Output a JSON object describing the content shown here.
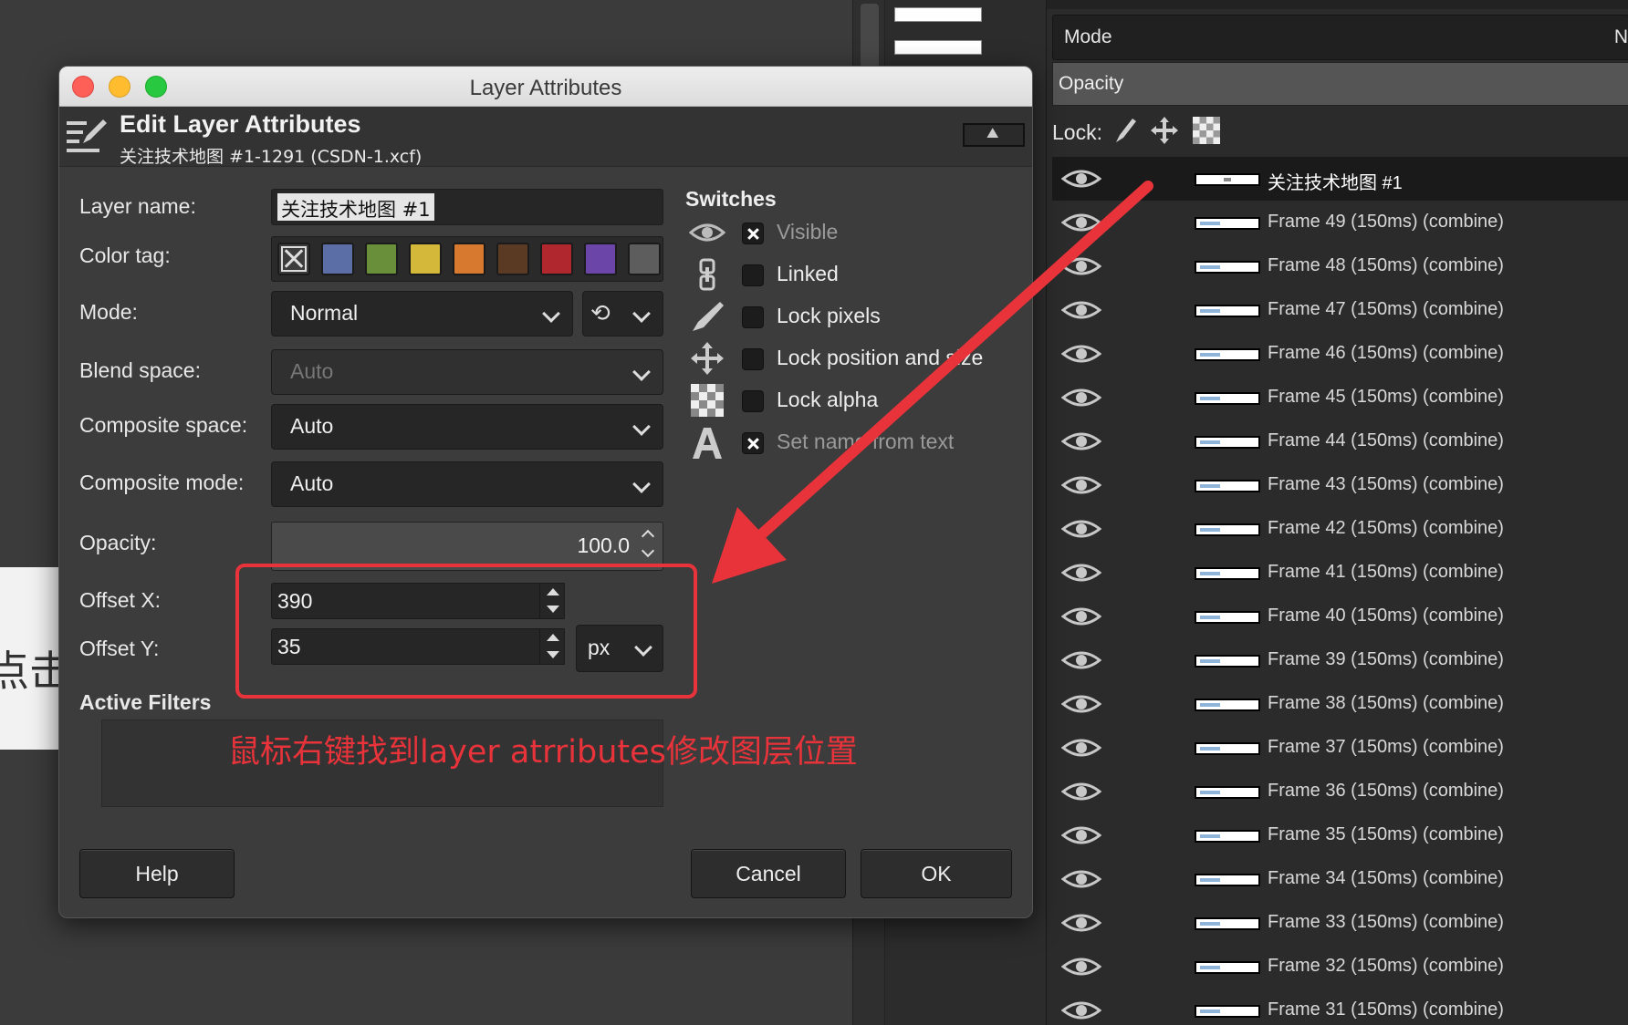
{
  "dialog": {
    "window_title": "Layer Attributes",
    "header_title": "Edit Layer Attributes",
    "header_subtitle": "关注技术地图 #1-1291 (CSDN-1.xcf)",
    "labels": {
      "layer_name": "Layer name:",
      "color_tag": "Color tag:",
      "mode": "Mode:",
      "blend_space": "Blend space:",
      "composite_space": "Composite space:",
      "composite_mode": "Composite mode:",
      "opacity": "Opacity:",
      "offset_x": "Offset X:",
      "offset_y": "Offset Y:",
      "active_filters": "Active Filters"
    },
    "layer_name_value": "关注技术地图 #1",
    "color_tags": [
      "#5b6fa6",
      "#6a8f3a",
      "#d4b83a",
      "#d77a2f",
      "#5a3a22",
      "#b0282e",
      "#6b45a8",
      "#5d5d5d"
    ],
    "mode_value": "Normal",
    "blend_space_value": "Auto",
    "composite_space_value": "Auto",
    "composite_mode_value": "Auto",
    "opacity_value": "100.0",
    "offset_x_value": "390",
    "offset_y_value": "35",
    "unit_value": "px",
    "switches": {
      "title": "Switches",
      "items": [
        {
          "label": "Visible",
          "checked": true,
          "dim": true
        },
        {
          "label": "Linked",
          "checked": false,
          "dim": false
        },
        {
          "label": "Lock pixels",
          "checked": false,
          "dim": false
        },
        {
          "label": "Lock position and size",
          "checked": false,
          "dim": false
        },
        {
          "label": "Lock alpha",
          "checked": false,
          "dim": false
        },
        {
          "label": "Set name from text",
          "checked": true,
          "dim": true
        }
      ]
    },
    "buttons": {
      "help": "Help",
      "cancel": "Cancel",
      "ok": "OK"
    }
  },
  "annotation": {
    "text": "鼠标右键找到layer atrributes修改图层位置",
    "color": "#e8333a"
  },
  "background": {
    "canvas_fragment_text": "点击"
  },
  "layers_panel": {
    "mode_label": "Mode",
    "mode_trailing": "N",
    "opacity_label": "Opacity",
    "lock_label": "Lock:",
    "layers": [
      {
        "name": "关注技术地图 #1",
        "active": true
      },
      {
        "name": "Frame 49 (150ms) (combine)"
      },
      {
        "name": "Frame 48 (150ms) (combine)"
      },
      {
        "name": "Frame 47 (150ms) (combine)"
      },
      {
        "name": "Frame 46 (150ms) (combine)"
      },
      {
        "name": "Frame 45 (150ms) (combine)"
      },
      {
        "name": "Frame 44 (150ms) (combine)"
      },
      {
        "name": "Frame 43 (150ms) (combine)"
      },
      {
        "name": "Frame 42 (150ms) (combine)"
      },
      {
        "name": "Frame 41 (150ms) (combine)"
      },
      {
        "name": "Frame 40 (150ms) (combine)"
      },
      {
        "name": "Frame 39 (150ms) (combine)"
      },
      {
        "name": "Frame 38 (150ms) (combine)"
      },
      {
        "name": "Frame 37 (150ms) (combine)"
      },
      {
        "name": "Frame 36 (150ms) (combine)"
      },
      {
        "name": "Frame 35 (150ms) (combine)"
      },
      {
        "name": "Frame 34 (150ms) (combine)"
      },
      {
        "name": "Frame 33 (150ms) (combine)"
      },
      {
        "name": "Frame 32 (150ms) (combine)"
      },
      {
        "name": "Frame 31 (150ms) (combine)"
      }
    ]
  }
}
